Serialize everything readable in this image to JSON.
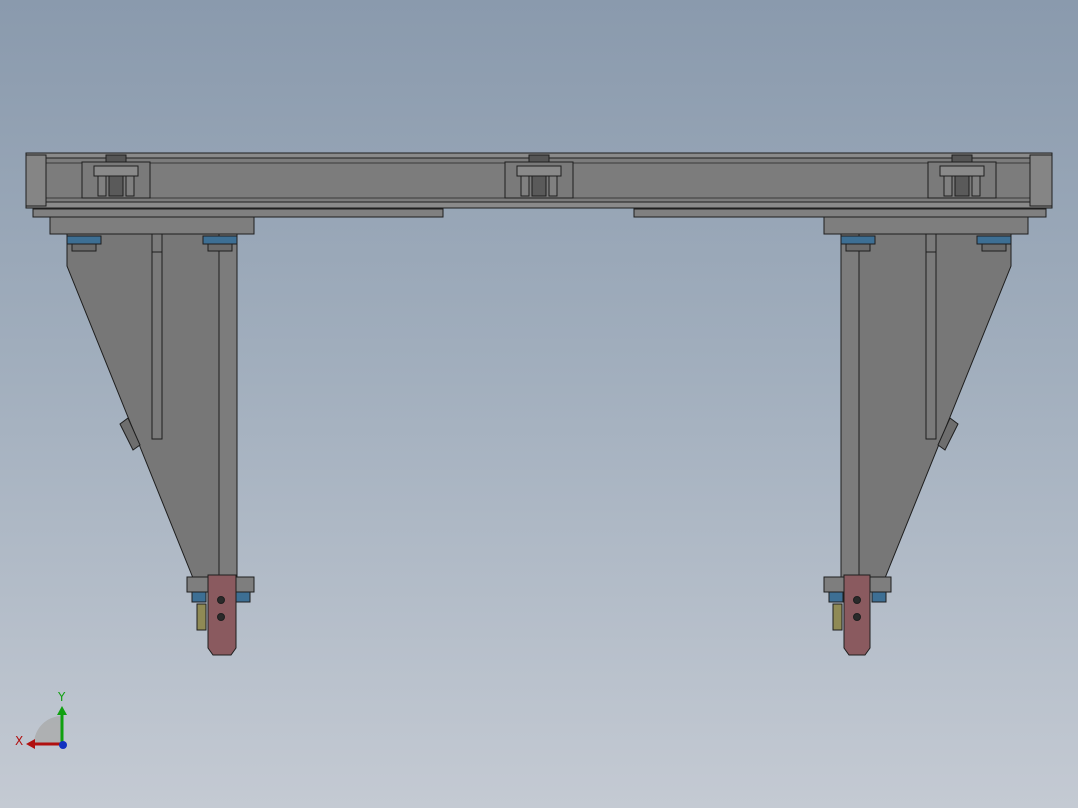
{
  "triad": {
    "x_label": "X",
    "y_label": "Y"
  },
  "colors": {
    "background_top": "#8a9aad",
    "background_bottom": "#c4cad3",
    "steel": "#7a7a7a",
    "steel_dark": "#6e6e6e",
    "edge": "#1e1e1e",
    "bolt": "#3d6f94",
    "bracket": "#8a5a5f",
    "brass": "#8f8a55",
    "axis_x": "#b01010",
    "axis_y": "#10a010",
    "axis_z": "#1030c0"
  },
  "icons": {
    "triad": "coordinate-triad-icon"
  }
}
